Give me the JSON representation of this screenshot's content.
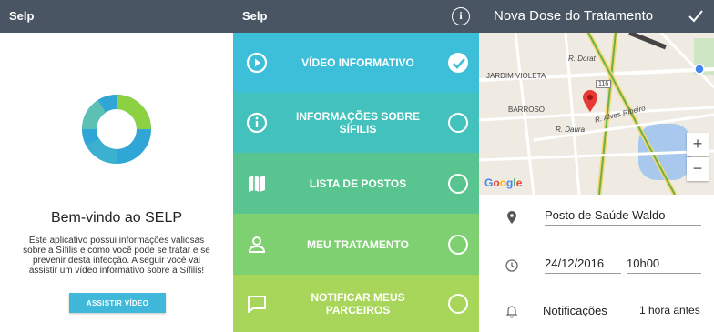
{
  "colors": {
    "app_bar": "#4a5563",
    "menu_video": "#3dbfd9",
    "menu_info": "#43c1bd",
    "menu_postos": "#58c48f",
    "menu_tratamento": "#7fd071",
    "menu_parceiros": "#a8d65a",
    "button": "#3fb8d9",
    "logo_blue": "#2fa6d6",
    "logo_green": "#8bd142"
  },
  "welcome_screen": {
    "app_title": "Selp",
    "heading": "Bem-vindo ao SELP",
    "description_lines": [
      "Este aplicativo possui informações valiosas",
      "sobre a Sífilis e como você pode se tratar e se",
      "prevenir desta infecção. A seguir você vai",
      "assistir um vídeo informativo sobre a Sífilis!"
    ],
    "watch_button": "ASSISTIR VÍDEO"
  },
  "menu_screen": {
    "app_title": "Selp",
    "info_icon": "info-circle-icon",
    "items": [
      {
        "label_lines": [
          "VÍDEO INFORMATIVO"
        ],
        "icon": "play-icon",
        "done": true
      },
      {
        "label_lines": [
          "INFORMAÇÕES SOBRE",
          "SÍFILIS"
        ],
        "icon": "info-icon",
        "done": false
      },
      {
        "label_lines": [
          "LISTA DE POSTOS"
        ],
        "icon": "map-icon",
        "done": false
      },
      {
        "label_lines": [
          "MEU TRATAMENTO"
        ],
        "icon": "person-icon",
        "done": false
      },
      {
        "label_lines": [
          "NOTIFICAR MEUS",
          "PARCEIROS"
        ],
        "icon": "message-icon",
        "done": false
      }
    ]
  },
  "dose_screen": {
    "title": "Nova Dose do Tratamento",
    "confirm_icon": "check-icon",
    "map": {
      "labels": [
        "JARDIM VIOLETA",
        "R. Dorat",
        "BARROSO",
        "R. Daura",
        "R. Alves Ribeiro",
        "116"
      ],
      "attribution": "Google",
      "zoom_in": "+",
      "zoom_out": "−"
    },
    "location": "Posto de Saúde Waldo",
    "date": "24/12/2016",
    "time": "10h00",
    "notifications_label": "Notificações",
    "notifications_value": "1 hora antes"
  }
}
